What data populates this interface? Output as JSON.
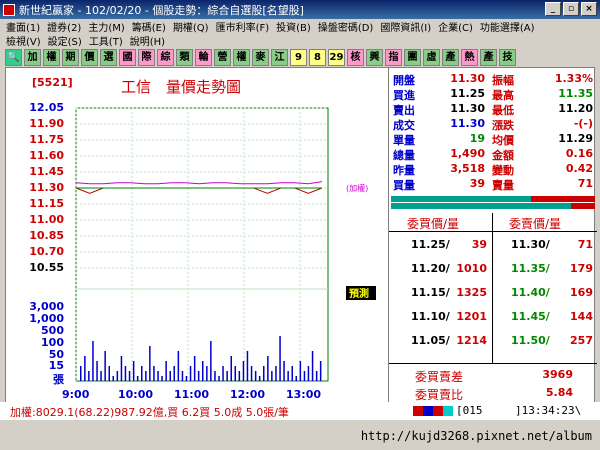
{
  "window": {
    "title": "新世紀贏家 - 102/02/20 - 個股走勢：綜合自選股[名望股]"
  },
  "menu": {
    "row1": [
      "畫面(1)",
      "證券(2)",
      "主力(M)",
      "籌碼(E)",
      "期權(Q)",
      "匯市利率(F)",
      "投資(B)",
      "操盤密碼(D)",
      "國際資訊(I)",
      "企業(C)",
      "功能選擇(A)"
    ],
    "row2": [
      "檢視(V)",
      "設定(S)",
      "工具(T)",
      "說明(H)"
    ]
  },
  "toolbar": {
    "buttons": [
      "加",
      "權",
      "期",
      "價",
      "選",
      "國",
      "際",
      "綜",
      "類",
      "輪",
      "營",
      "權",
      "麥",
      "江",
      "9",
      "8",
      "29",
      "核",
      "興",
      "指",
      "團",
      "虛",
      "產",
      "熱",
      "產",
      "技"
    ]
  },
  "chart": {
    "stock_id": "[5521]",
    "title": "工信　量價走勢圖",
    "price_labels": [
      "12.05",
      "11.90",
      "11.75",
      "11.60",
      "11.45",
      "11.30",
      "11.15",
      "11.00",
      "10.85",
      "10.70",
      "10.55"
    ],
    "volume_labels": [
      "3,000",
      "1,000",
      "500",
      "100",
      "50",
      "15",
      "張"
    ],
    "time_labels": [
      "9:00",
      "10:00",
      "11:00",
      "12:00",
      "13:00"
    ],
    "avg_label": "(加權)",
    "predict_label": "預測",
    "line_colors": {
      "price": "#c00000",
      "avg": "#cc00cc",
      "ref": "#008000",
      "volume": "#0000cc"
    }
  },
  "chart_data": {
    "type": "line",
    "x": [
      "9:00",
      "9:15",
      "9:30",
      "9:45",
      "10:00",
      "10:15",
      "10:30",
      "10:45",
      "11:00",
      "11:15",
      "11:30",
      "11:45",
      "12:00",
      "12:15",
      "12:30",
      "12:45",
      "13:00",
      "13:15",
      "13:30"
    ],
    "series": [
      {
        "values": [
          11.3,
          11.25,
          11.3,
          11.3,
          11.3,
          11.3,
          11.3,
          11.3,
          11.3,
          11.3,
          11.3,
          11.3,
          11.3,
          11.3,
          11.25,
          11.3,
          11.3,
          11.25,
          11.3
        ]
      },
      {
        "values": [
          11.35,
          11.34,
          11.34,
          11.35,
          11.35,
          11.34,
          11.34,
          11.35,
          11.35,
          11.34,
          11.35,
          11.35,
          11.34,
          11.34,
          11.34,
          11.35,
          11.35,
          11.34,
          11.36
        ]
      },
      {
        "values": [
          11.3,
          11.3,
          11.3,
          11.3,
          11.3,
          11.3,
          11.3,
          11.3,
          11.3,
          11.3,
          11.3,
          11.3,
          11.3,
          11.3,
          11.3,
          11.3,
          11.3,
          11.3,
          11.3
        ]
      }
    ],
    "ylim": [
      10.55,
      12.05
    ]
  },
  "quote": {
    "rows": [
      {
        "l1": "開盤",
        "v1": "11.30",
        "l2": "振幅",
        "v2": "1.33%",
        "c1": "#c00",
        "c2": "#c00"
      },
      {
        "l1": "買進",
        "v1": "11.25",
        "l2": "最高",
        "v2": "11.35",
        "c1": "#000",
        "c2": "#080"
      },
      {
        "l1": "賣出",
        "v1": "11.30",
        "l2": "最低",
        "v2": "11.20",
        "c1": "#000",
        "c2": "#000"
      },
      {
        "l1": "成交",
        "v1": "11.30",
        "l2": "漲跌",
        "v2": "-(-)",
        "c1": "#00c",
        "c2": "#c00"
      },
      {
        "l1": "單量",
        "v1": "19",
        "l2": "均價",
        "v2": "11.29",
        "c1": "#080",
        "c2": "#000"
      },
      {
        "l1": "總量",
        "v1": "1,490",
        "l2": "金額",
        "v2": "0.16",
        "c1": "#c00",
        "c2": "#c00"
      },
      {
        "l1": "昨量",
        "v1": "3,518",
        "l2": "變動",
        "v2": "0.42",
        "c1": "#c00",
        "c2": "#c00"
      },
      {
        "l1": "買量",
        "v1": "39",
        "l2": "賣量",
        "v2": "71",
        "c1": "#c00",
        "c2": "#c00"
      }
    ]
  },
  "orderbook": {
    "bid_header": "委買價/量",
    "ask_header": "委賣價/量",
    "rows": [
      {
        "bp": "11.25/",
        "bv": "39",
        "ap": "11.30/",
        "av": "71"
      },
      {
        "bp": "11.20/",
        "bv": "1010",
        "ap": "11.35/",
        "av": "179"
      },
      {
        "bp": "11.15/",
        "bv": "1325",
        "ap": "11.40/",
        "av": "169"
      },
      {
        "bp": "11.10/",
        "bv": "1201",
        "ap": "11.45/",
        "av": "144"
      },
      {
        "bp": "11.05/",
        "bv": "1214",
        "ap": "11.50/",
        "av": "257"
      }
    ],
    "diff_label": "委買賣差",
    "diff_value": "3969",
    "ratio_label": "委買賣比",
    "ratio_value": "5.84"
  },
  "status": {
    "text": "加權:8029.1(68.22)987.92億,買 6.2買 5.0成 5.0張/筆",
    "code": "[015",
    "time": "]13:34:23\\"
  },
  "url": "http://kujd3268.pixnet.net/album"
}
